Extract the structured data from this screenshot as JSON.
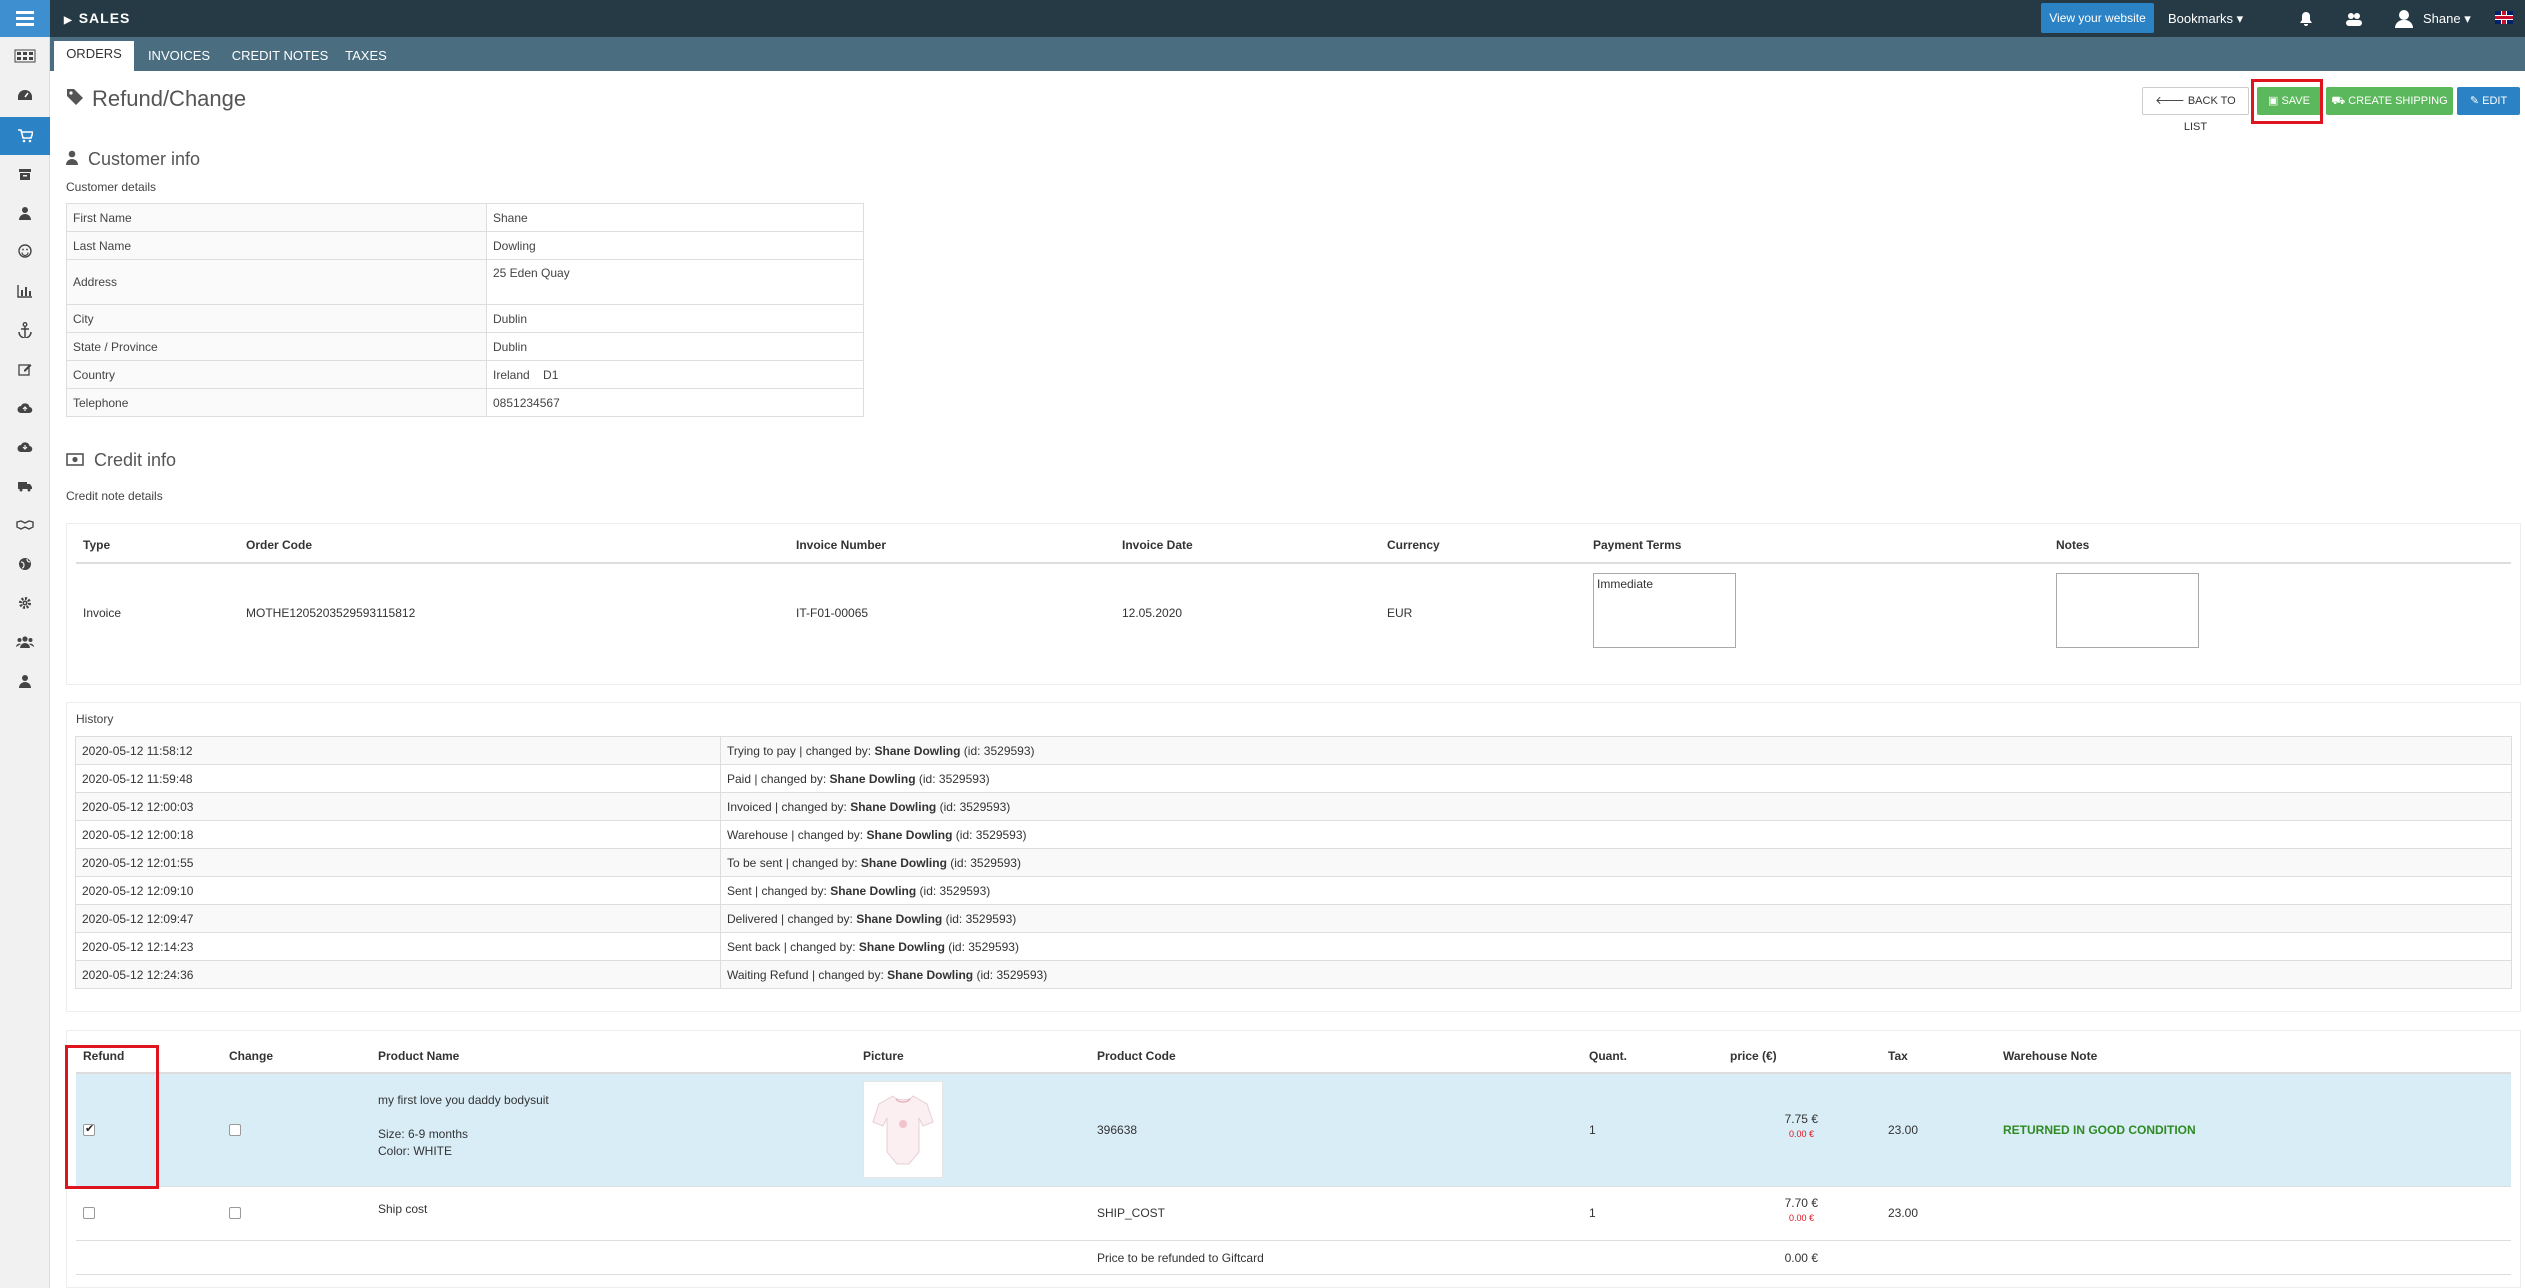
{
  "topbar": {
    "section": "SALES",
    "view_website": "View your website",
    "bookmarks": "Bookmarks ▾",
    "user": "Shane ▾"
  },
  "tabs": [
    {
      "label": "ORDERS",
      "active": true
    },
    {
      "label": "INVOICES",
      "active": false
    },
    {
      "label": "CREDIT NOTES",
      "active": false
    },
    {
      "label": "TAXES",
      "active": false
    }
  ],
  "page": {
    "title": "Refund/Change",
    "buttons": {
      "back": "BACK TO LIST",
      "save": "SAVE",
      "create_shipping": "CREATE SHIPPING",
      "edit": "EDIT"
    }
  },
  "customer": {
    "heading": "Customer info",
    "subheading": "Customer details",
    "rows": [
      {
        "label": "First Name",
        "value": "Shane"
      },
      {
        "label": "Last Name",
        "value": "Dowling"
      },
      {
        "label": "Address",
        "value": "25 Eden Quay"
      },
      {
        "label": "City",
        "value": "Dublin"
      },
      {
        "label": "State / Province",
        "value": "Dublin"
      },
      {
        "label": "Country",
        "value": "Ireland    D1"
      },
      {
        "label": "Telephone",
        "value": "0851234567"
      }
    ]
  },
  "credit": {
    "heading": "Credit info",
    "subheading": "Credit note details",
    "headers": {
      "type": "Type",
      "order_code": "Order Code",
      "invoice_number": "Invoice Number",
      "invoice_date": "Invoice Date",
      "currency": "Currency",
      "payment_terms": "Payment Terms",
      "notes": "Notes"
    },
    "values": {
      "type": "Invoice",
      "order_code": "MOTHE1205203529593115812",
      "invoice_number": "IT-F01-00065",
      "invoice_date": "12.05.2020",
      "currency": "EUR",
      "payment_terms": "Immediate",
      "notes": ""
    }
  },
  "history": {
    "label": "History",
    "changed_by_prefix": " | changed by: ",
    "rows": [
      {
        "date": "2020-05-12 11:58:12",
        "status": "Trying to pay",
        "user": "Shane Dowling",
        "id": " (id: 3529593)"
      },
      {
        "date": "2020-05-12 11:59:48",
        "status": "Paid",
        "user": "Shane Dowling",
        "id": " (id: 3529593)"
      },
      {
        "date": "2020-05-12 12:00:03",
        "status": "Invoiced",
        "user": "Shane Dowling",
        "id": " (id: 3529593)"
      },
      {
        "date": "2020-05-12 12:00:18",
        "status": "Warehouse",
        "user": "Shane Dowling",
        "id": " (id: 3529593)"
      },
      {
        "date": "2020-05-12 12:01:55",
        "status": "To be sent",
        "user": "Shane Dowling",
        "id": " (id: 3529593)"
      },
      {
        "date": "2020-05-12 12:09:10",
        "status": "Sent",
        "user": "Shane Dowling",
        "id": " (id: 3529593)"
      },
      {
        "date": "2020-05-12 12:09:47",
        "status": "Delivered",
        "user": "Shane Dowling",
        "id": " (id: 3529593)"
      },
      {
        "date": "2020-05-12 12:14:23",
        "status": "Sent back",
        "user": "Shane Dowling",
        "id": " (id: 3529593)"
      },
      {
        "date": "2020-05-12 12:24:36",
        "status": "Waiting Refund",
        "user": "Shane Dowling",
        "id": " (id: 3529593)"
      }
    ]
  },
  "products": {
    "headers": {
      "refund": "Refund",
      "change": "Change",
      "product_name": "Product Name",
      "picture": "Picture",
      "product_code": "Product Code",
      "quant": "Quant.",
      "price": "price (€)",
      "tax": "Tax",
      "warehouse_note": "Warehouse Note"
    },
    "rows": [
      {
        "refund": true,
        "change": false,
        "name": "my first love you daddy bodysuit",
        "size": "Size: 6-9 months",
        "color": "Color: WHITE",
        "picture": "bodysuit-image",
        "code": "396638",
        "quant": "1",
        "price": "7.75 €",
        "price_sub": "0.00 €",
        "tax": "23.00",
        "warehouse_note": "RETURNED IN GOOD CONDITION"
      },
      {
        "refund": false,
        "change": false,
        "name": "Ship cost",
        "code": "SHIP_COST",
        "quant": "1",
        "price": "7.70 €",
        "price_sub": "0.00 €",
        "tax": "23.00",
        "warehouse_note": ""
      }
    ],
    "giftcard_label": "Price to be refunded to Giftcard",
    "giftcard_value": "0.00 €"
  },
  "colors": {
    "topbar": "#263a45",
    "accent": "#2b83c5",
    "success": "#5cb85c",
    "highlight_box": "#e0141e",
    "row_highlight": "#d9edf7"
  }
}
